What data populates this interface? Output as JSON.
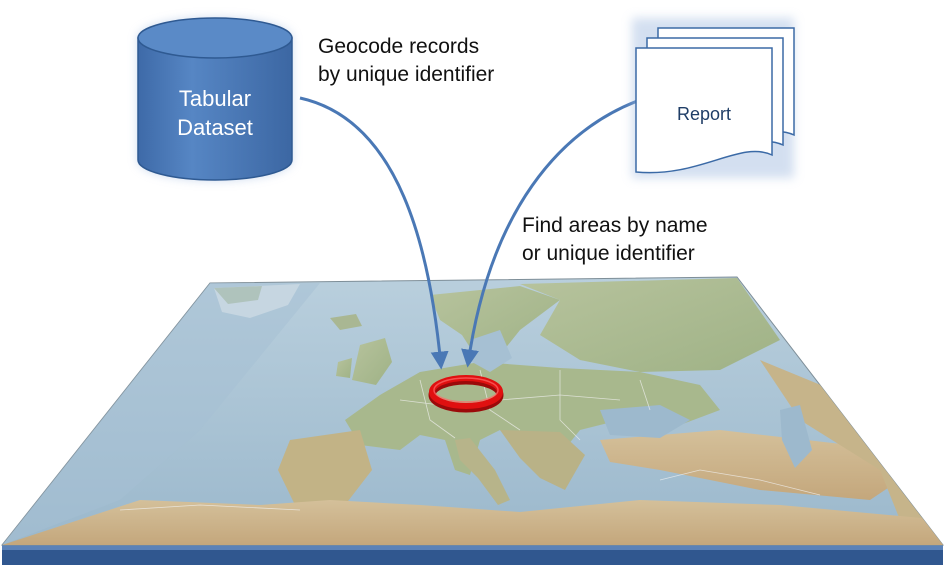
{
  "dataset": {
    "line1": "Tabular",
    "line2": "Dataset"
  },
  "report": {
    "label": "Report"
  },
  "annotations": {
    "geocode_line1": "Geocode records",
    "geocode_line2": "by unique identifier",
    "find_line1": "Find areas by name",
    "find_line2": "or unique identifier"
  },
  "colors": {
    "cylinder_fill": "#4f7fbf",
    "cylinder_stroke": "#2f5a92",
    "report_stroke": "#3b6aa6",
    "arrow": "#4a78b5",
    "highlight_ring": "#e01010",
    "map_base": "#30578f",
    "sea": "#a9c3d6",
    "land": "#c9b892"
  },
  "icons": {
    "dataset": "database-cylinder-icon",
    "report": "stacked-documents-icon",
    "highlight": "highlight-ring-icon"
  }
}
